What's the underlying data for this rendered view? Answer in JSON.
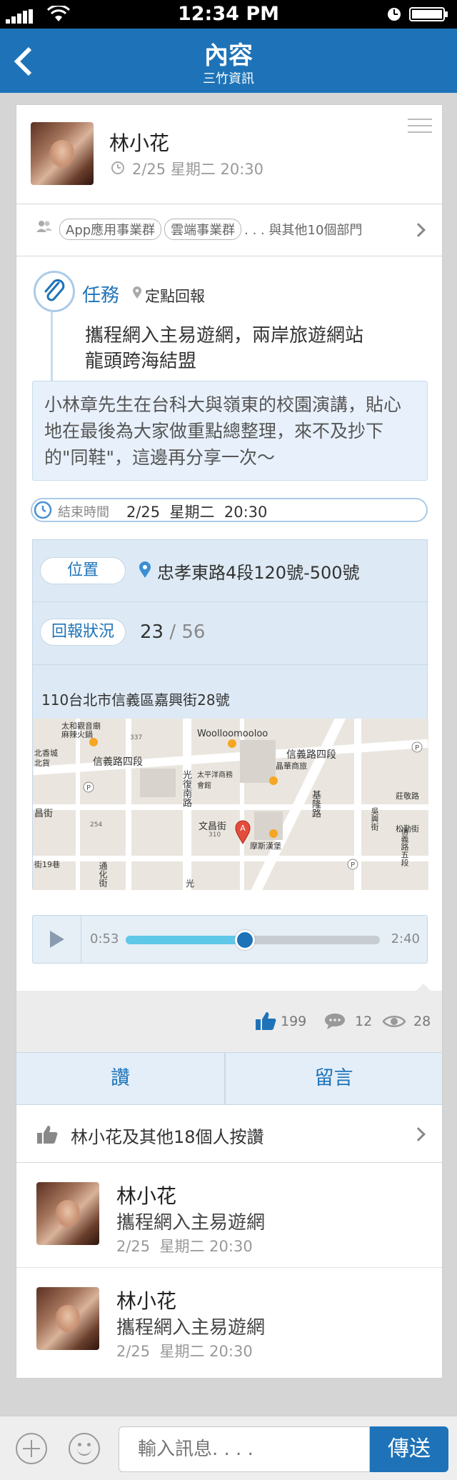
{
  "status_bar": {
    "time": "12:34 PM"
  },
  "nav": {
    "title": "內容",
    "subtitle": "三竹資訊"
  },
  "post": {
    "author": "林小花",
    "time": "2/25  星期二 20:30",
    "departments": [
      "App應用事業群",
      "雲端事業群"
    ],
    "departments_more": ". . . 與其他10個部門",
    "task_label": "任務",
    "task_type": "定點回報",
    "headline_line1": "攜程網入主易遊網，兩岸旅遊網站",
    "headline_line2": "龍頭跨海結盟",
    "body": "小林章先生在台科大與嶺東的校園演講，貼心地在最後為大家做重點總整理，來不及抄下的\"同鞋\"，這邊再分享一次～",
    "end_time_label": "結束時間",
    "end_time_value": "2/25  星期二  20:30",
    "location_label": "位置",
    "location_value": "忠孝東路4段120號-500號",
    "report_label": "回報狀況",
    "report_done": "23",
    "report_sep": " / ",
    "report_total": "56",
    "address": "110台北市信義區嘉興街28號",
    "map_labels": [
      "太和觀音廟",
      "麻辣火鍋",
      "Woolloomooloo",
      "信義路四段",
      "信義路四段",
      "晶華商旅",
      "光復南路",
      "太平洋商務會館",
      "北香城",
      "北貨",
      "昌街",
      "文昌街",
      "摩斯漢堡",
      "基隆路",
      "吳興街",
      "信義路五段",
      "莊敬路",
      "松勤街",
      "通化街",
      "街19巷",
      "337",
      "254",
      "310",
      "光"
    ],
    "audio": {
      "current": "0:53",
      "total": "2:40",
      "progress": 0.47
    },
    "likes": "199",
    "comments": "12",
    "views": "28"
  },
  "actions": {
    "like": "讚",
    "comment": "留言"
  },
  "likers_summary": "林小花及其他18個人按讚",
  "comment_list": [
    {
      "name": "林小花",
      "text": "攜程網入主易遊網",
      "time": "2/25  星期二 20:30"
    },
    {
      "name": "林小花",
      "text": "攜程網入主易遊網",
      "time": "2/25  星期二 20:30"
    }
  ],
  "composer": {
    "placeholder": "輸入訊息. . . .",
    "send": "傳送"
  },
  "colors": {
    "brand": "#1e73b8",
    "progress": "#5fc8e8",
    "bubble": "#e8f1fb",
    "info": "#dde9f4"
  }
}
